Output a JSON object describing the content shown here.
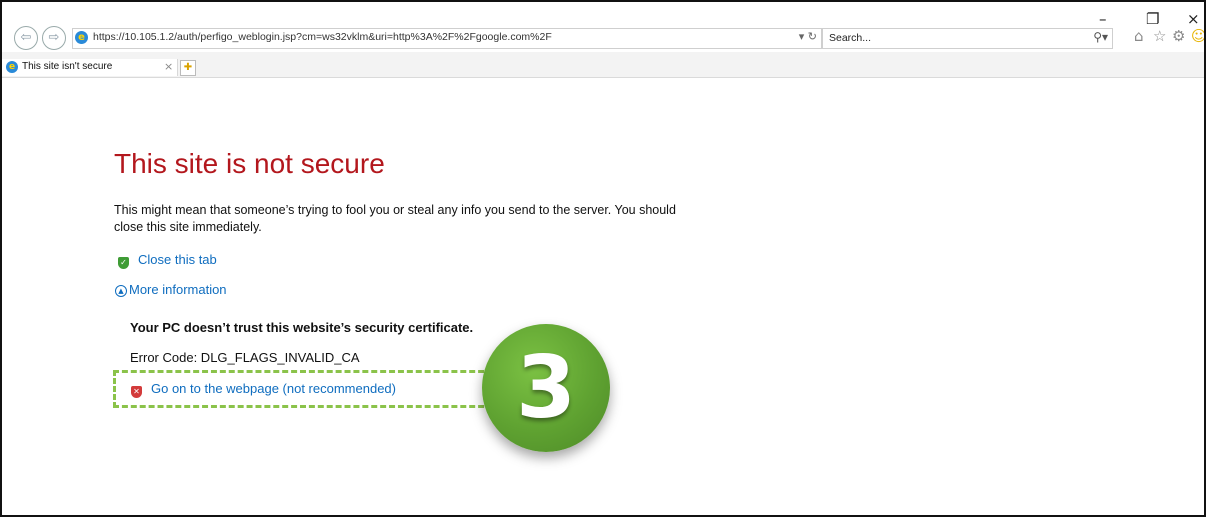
{
  "browser": {
    "url": "https://10.105.1.2/auth/perfigo_weblogin.jsp?cm=ws32vklm&uri=http%3A%2F%2Fgoogle.com%2F",
    "search_placeholder": "Search...",
    "back_icon": "back-arrow",
    "forward_icon": "forward-arrow",
    "tab_title": "This site isn't secure",
    "window_controls": {
      "minimize": "–",
      "restore": "❐",
      "close": "×"
    },
    "addr_controls": "▾ ↻",
    "search_controls": "⚲▾",
    "toolbar_icons": [
      "home-icon",
      "favorites-star-icon",
      "settings-gear-icon",
      "feedback-smiley-icon"
    ]
  },
  "page": {
    "title": "This site is not secure",
    "description": "This might mean that someone’s trying to fool you or steal any info you send to the server. You should close this site immediately.",
    "close_tab": "Close this tab",
    "more_info": "More information",
    "details_heading": "Your PC doesn’t trust this website’s security certificate.",
    "error_code": "Error Code: DLG_FLAGS_INVALID_CA",
    "go_on": "Go on to the webpage (not recommended)"
  },
  "annotation": {
    "step_number": "3",
    "badge_color": "#5fa231",
    "highlight_color": "#8bc34a"
  },
  "colors": {
    "title": "#b3171d",
    "link": "#0f6dbf"
  }
}
